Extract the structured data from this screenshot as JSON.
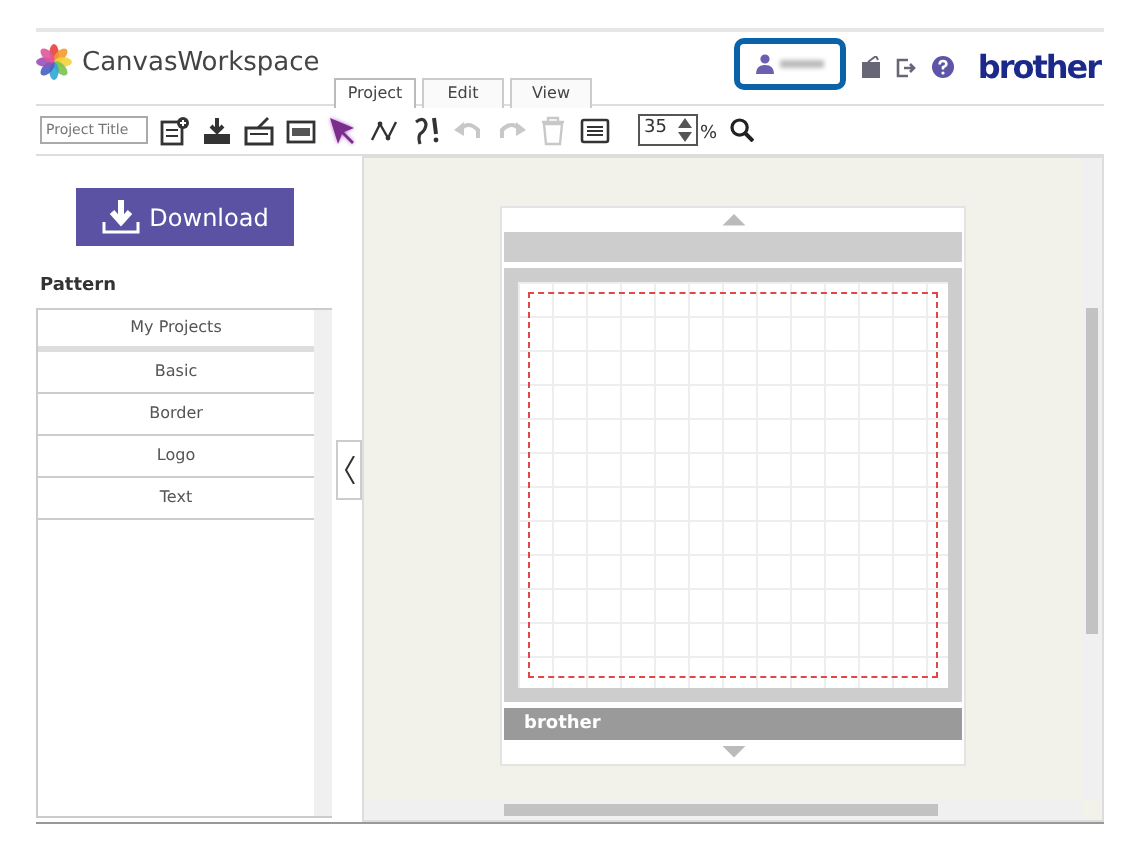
{
  "header": {
    "app_name": "CanvasWorkspace",
    "brand": "brother"
  },
  "tabs": [
    {
      "label": "Project",
      "selected": true
    },
    {
      "label": "Edit",
      "selected": false
    },
    {
      "label": "View",
      "selected": false
    }
  ],
  "toolbar": {
    "project_title": {
      "placeholder": "Project Title"
    },
    "tools": [
      {
        "kind": "new",
        "selected": false,
        "disabled": false
      },
      {
        "kind": "save",
        "selected": false,
        "disabled": false
      },
      {
        "kind": "open",
        "selected": false,
        "disabled": false
      },
      {
        "kind": "image",
        "selected": false,
        "disabled": false
      },
      {
        "kind": "select",
        "selected": true,
        "disabled": false
      },
      {
        "kind": "line",
        "selected": false,
        "disabled": false
      },
      {
        "kind": "draw",
        "selected": false,
        "disabled": false
      },
      {
        "kind": "undo",
        "selected": false,
        "disabled": true
      },
      {
        "kind": "redo",
        "selected": false,
        "disabled": true
      },
      {
        "kind": "delete",
        "selected": false,
        "disabled": true
      },
      {
        "kind": "list",
        "selected": false,
        "disabled": false
      }
    ],
    "zoom": "35",
    "zoom_unit": "%"
  },
  "sidebar": {
    "download_button": "Download",
    "pattern_heading": "Pattern",
    "items": [
      {
        "label": "My Projects"
      },
      {
        "label": "Basic"
      },
      {
        "label": "Border"
      },
      {
        "label": "Logo"
      },
      {
        "label": "Text"
      }
    ]
  },
  "mat": {
    "brand": "brother"
  }
}
